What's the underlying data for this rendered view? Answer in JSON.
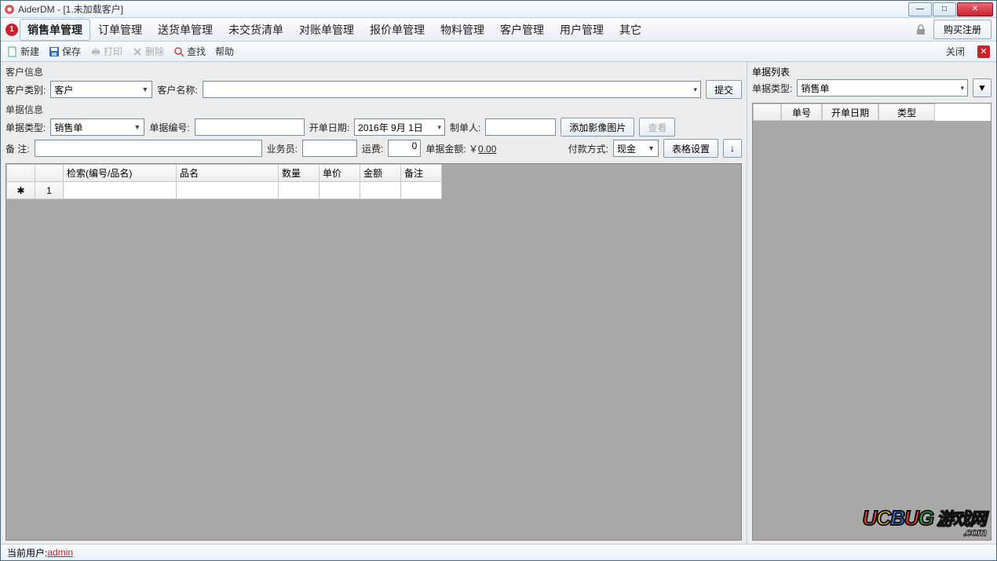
{
  "title": "AiderDM - [1.未加载客户]",
  "win_buttons": {
    "min": "—",
    "max": "□",
    "close": "✕"
  },
  "menu": {
    "badge": "1",
    "items": [
      "销售单管理",
      "订单管理",
      "送货单管理",
      "未交货清单",
      "对账单管理",
      "报价单管理",
      "物料管理",
      "客户管理",
      "用户管理",
      "其它"
    ],
    "register": "购买注册"
  },
  "toolbar": {
    "new": "新建",
    "save": "保存",
    "print": "打印",
    "delete": "删除",
    "search": "查找",
    "help": "帮助",
    "close": "关闭"
  },
  "customer": {
    "group_label": "客户信息",
    "type_label": "客户类别:",
    "type_value": "客户",
    "name_label": "客户名称:",
    "name_value": "",
    "submit": "提交"
  },
  "order": {
    "group_label": "单据信息",
    "type_label": "单据类型:",
    "type_value": "销售单",
    "number_label": "单据编号:",
    "number_value": "",
    "date_label": "开单日期:",
    "date_value": "2016年 9月 1日",
    "maker_label": "制单人:",
    "maker_value": "",
    "add_image": "添加影像图片",
    "view": "查看",
    "remark_label": "备    注:",
    "remark_value": "",
    "staff_label": "业务员:",
    "staff_value": "",
    "freight_label": "运费:",
    "freight_value": "0",
    "amount_label": "单据金额: ￥",
    "amount_value": "0.00",
    "pay_label": "付款方式:",
    "pay_value": "现金",
    "table_settings": "表格设置",
    "down_arrow": "↓"
  },
  "grid": {
    "headers": [
      "检索(编号/品名)",
      "品名",
      "数量",
      "单价",
      "金额",
      "备注"
    ],
    "row_marker": "✱",
    "row_num": "1"
  },
  "right": {
    "group_label": "单据列表",
    "type_label": "单据类型:",
    "type_value": "销售单",
    "dropdown": "▼",
    "headers": [
      "单号",
      "开单日期",
      "类型"
    ]
  },
  "status": {
    "label": "当前用户: ",
    "user": "admin"
  },
  "watermark": {
    "u": "U",
    "c": "C",
    "b": "B",
    "u2": "U",
    "g": "G",
    "cn": "游戏网",
    "com": ".com"
  }
}
